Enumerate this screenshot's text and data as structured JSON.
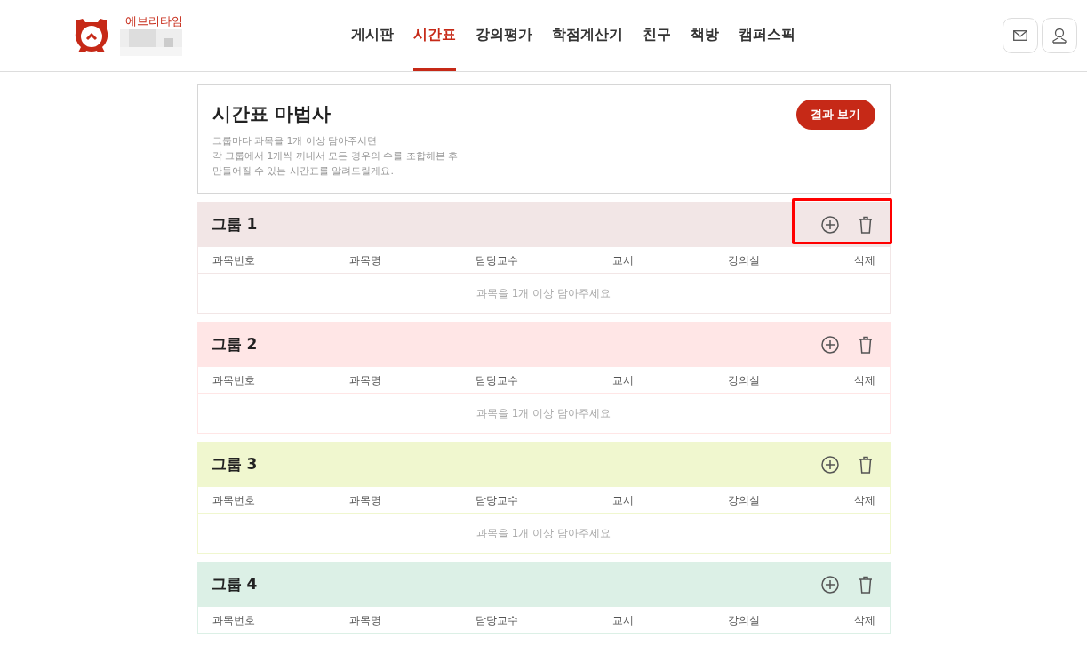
{
  "header": {
    "brand": "에브리타임",
    "nav": [
      {
        "label": "게시판",
        "selected": false
      },
      {
        "label": "시간표",
        "selected": true
      },
      {
        "label": "강의평가",
        "selected": false
      },
      {
        "label": "학점계산기",
        "selected": false
      },
      {
        "label": "친구",
        "selected": false
      },
      {
        "label": "책방",
        "selected": false
      },
      {
        "label": "캠퍼스픽",
        "selected": false
      }
    ]
  },
  "wizard": {
    "title": "시간표 마법사",
    "description": [
      "그룹마다 과목을 1개 이상 담아주시면",
      "각 그룹에서 1개씩 꺼내서 모든 경우의 수를 조합해본 후",
      "만들어질 수 있는 시간표를 알려드릴게요."
    ],
    "button": "결과 보기"
  },
  "groups": [
    {
      "title": "그룹 1",
      "color": "#f2e6e6",
      "highlighted": true,
      "columns": [
        "과목번호",
        "과목명",
        "담당교수",
        "교시",
        "강의실",
        "삭제"
      ],
      "empty_message": "과목을 1개 이상 담아주세요"
    },
    {
      "title": "그룹 2",
      "color": "#ffe6e6",
      "highlighted": false,
      "columns": [
        "과목번호",
        "과목명",
        "담당교수",
        "교시",
        "강의실",
        "삭제"
      ],
      "empty_message": "과목을 1개 이상 담아주세요"
    },
    {
      "title": "그룹 3",
      "color": "#f0f7cf",
      "highlighted": false,
      "columns": [
        "과목번호",
        "과목명",
        "담당교수",
        "교시",
        "강의실",
        "삭제"
      ],
      "empty_message": "과목을 1개 이상 담아주세요"
    },
    {
      "title": "그룹 4",
      "color": "#dcf0e6",
      "highlighted": false,
      "columns": [
        "과목번호",
        "과목명",
        "담당교수",
        "교시",
        "강의실",
        "삭제"
      ]
    }
  ]
}
